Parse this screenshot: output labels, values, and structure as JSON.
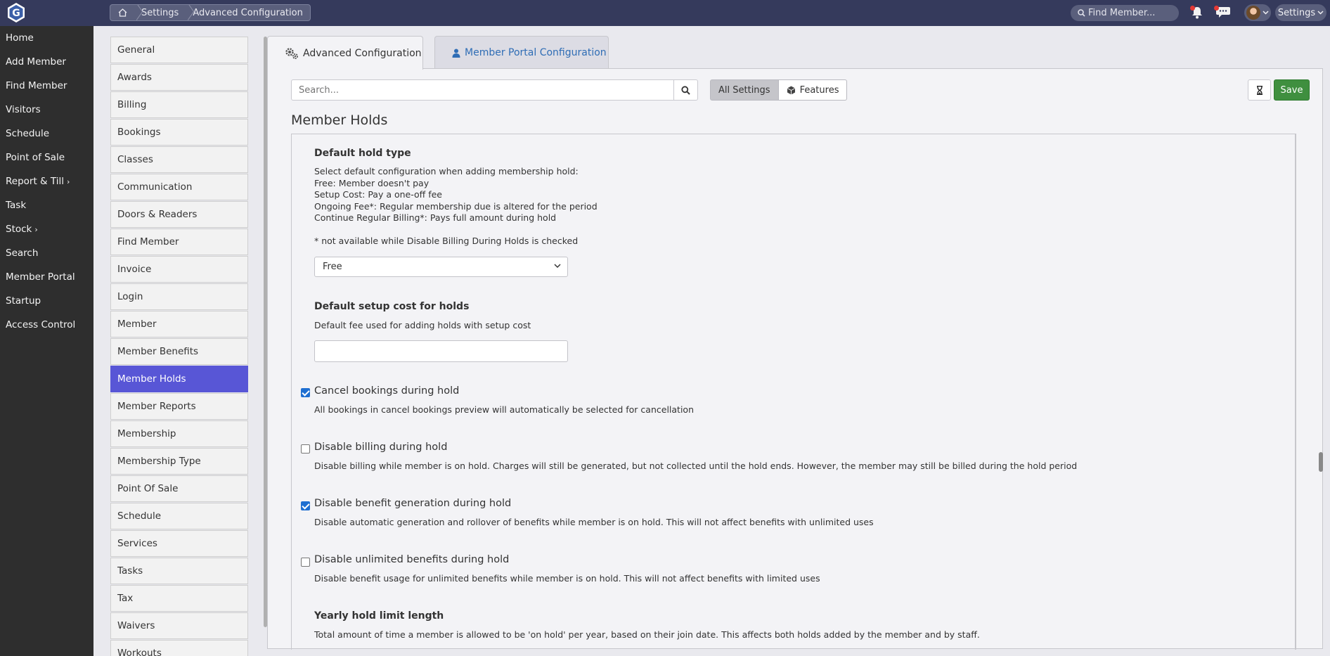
{
  "breadcrumb": {
    "items": [
      "Settings",
      "Advanced Configuration"
    ]
  },
  "topbar": {
    "search_placeholder": "Find Member...",
    "settings_label": "Settings"
  },
  "leftnav": {
    "items": [
      {
        "label": "Home"
      },
      {
        "label": "Add Member"
      },
      {
        "label": "Find Member"
      },
      {
        "label": "Visitors"
      },
      {
        "label": "Schedule"
      },
      {
        "label": "Point of Sale"
      },
      {
        "label": "Report & Till",
        "submenu": true
      },
      {
        "label": "Task"
      },
      {
        "label": "Stock",
        "submenu": true
      },
      {
        "label": "Search"
      },
      {
        "label": "Member Portal"
      },
      {
        "label": "Startup"
      },
      {
        "label": "Access Control"
      }
    ]
  },
  "categories": {
    "items": [
      "General",
      "Awards",
      "Billing",
      "Bookings",
      "Classes",
      "Communication",
      "Doors & Readers",
      "Find Member",
      "Invoice",
      "Login",
      "Member",
      "Member Benefits",
      "Member Holds",
      "Member Reports",
      "Membership",
      "Membership Type",
      "Point Of Sale",
      "Schedule",
      "Services",
      "Tasks",
      "Tax",
      "Waivers",
      "Workouts"
    ],
    "active": "Member Holds"
  },
  "tabs": {
    "advanced": "Advanced Configuration",
    "portal": "Member Portal Configuration"
  },
  "toolbar": {
    "search_placeholder": "Search...",
    "all_settings": "All Settings",
    "features": "Features",
    "save": "Save"
  },
  "section": {
    "title": "Member Holds",
    "default_hold": {
      "label": "Default hold type",
      "lines": [
        "Select default configuration when adding membership hold:",
        "Free: Member doesn't pay",
        "Setup Cost: Pay a one-off fee",
        "Ongoing Fee*: Regular membership due is altered for the period",
        "Continue Regular Billing*: Pays full amount during hold"
      ],
      "note": "* not available while Disable Billing During Holds is checked",
      "selected": "Free"
    },
    "setup_cost": {
      "label": "Default setup cost for holds",
      "desc": "Default fee used for adding holds with setup cost",
      "value": ""
    },
    "cancel_bookings": {
      "label": "Cancel bookings during hold",
      "desc": "All bookings in cancel bookings preview will automatically be selected for cancellation",
      "checked": true
    },
    "disable_billing": {
      "label": "Disable billing during hold",
      "desc": "Disable billing while member is on hold. Charges will still be generated, but not collected until the hold ends. However, the member may still be billed during the hold period",
      "checked": false
    },
    "disable_benefit": {
      "label": "Disable benefit generation during hold",
      "desc": "Disable automatic generation and rollover of benefits while member is on hold. This will not affect benefits with unlimited uses",
      "checked": true
    },
    "disable_unlimited": {
      "label": "Disable unlimited benefits during hold",
      "desc": "Disable benefit usage for unlimited benefits while member is on hold. This will not affect benefits with limited uses",
      "checked": false
    },
    "yearly_limit": {
      "label": "Yearly hold limit length",
      "desc": "Total amount of time a member is allowed to be 'on hold' per year, based on their join date. This affects both holds added by the member and by staff."
    }
  },
  "colors": {
    "topbar": "#353a5c",
    "sidenav": "#2e2e2e",
    "active_category": "#5856d6",
    "save": "#3f8f3f",
    "link": "#2f6db5"
  }
}
